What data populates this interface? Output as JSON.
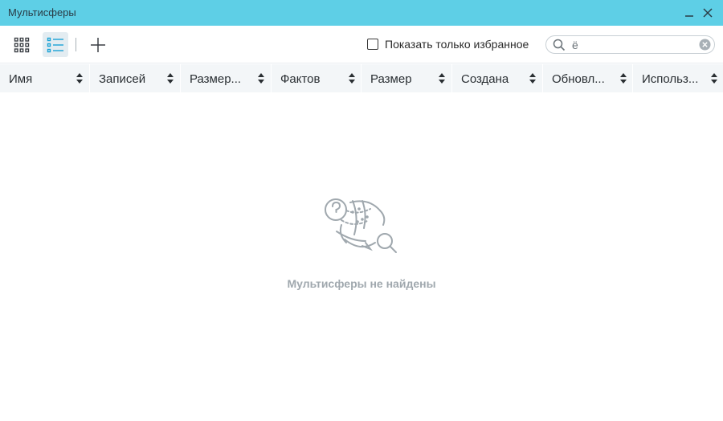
{
  "window": {
    "title": "Мультисферы"
  },
  "toolbar": {
    "favorites_label": "Показать только избранное",
    "favorites_checked": false,
    "search_value": "ё"
  },
  "columns": [
    {
      "label": "Имя"
    },
    {
      "label": "Записей"
    },
    {
      "label": "Размер..."
    },
    {
      "label": "Фактов"
    },
    {
      "label": "Размер"
    },
    {
      "label": "Создана"
    },
    {
      "label": "Обновл..."
    },
    {
      "label": "Использ..."
    }
  ],
  "empty_state": {
    "message": "Мультисферы не найдены"
  },
  "colors": {
    "titlebar": "#5ecfe6",
    "accent": "#1aa3d6",
    "header_bg": "#f3f6f8",
    "empty_text": "#a0a8ae"
  }
}
